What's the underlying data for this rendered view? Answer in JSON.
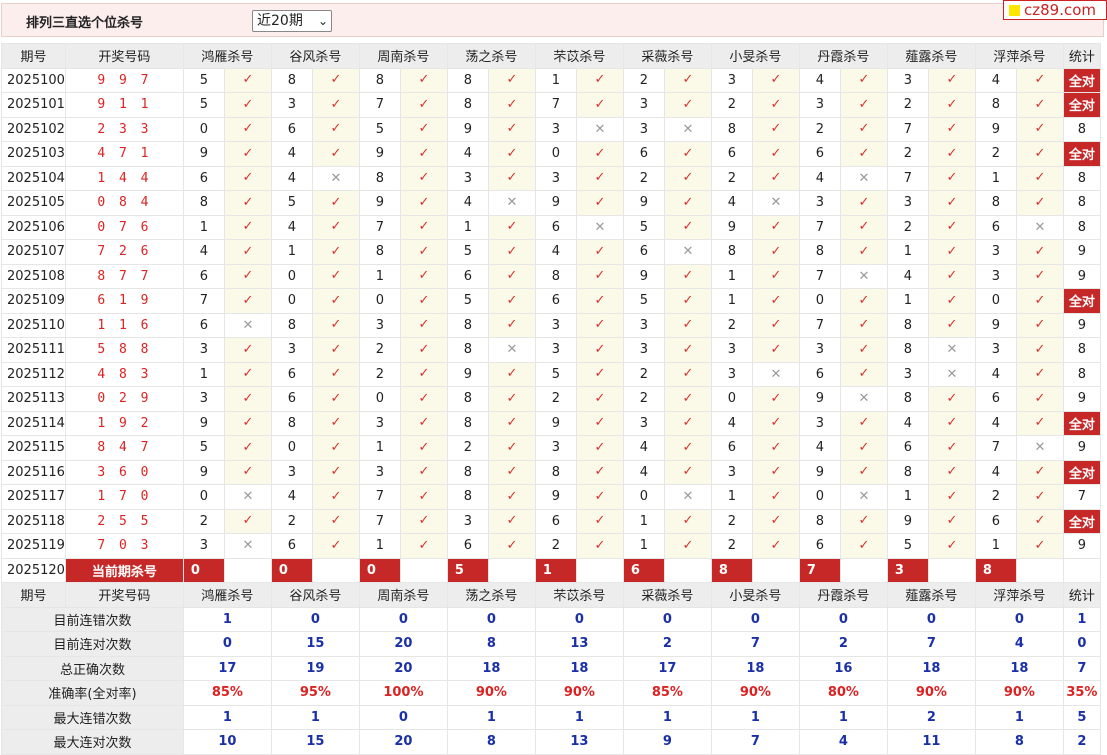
{
  "header": {
    "title": "排列三直选个位杀号",
    "range_label": "近20期",
    "logo_text": "cz89.com"
  },
  "columns": {
    "period": "期号",
    "draw": "开奖号码",
    "stat": "统计",
    "experts": [
      "鸿雁杀号",
      "谷风杀号",
      "周南杀号",
      "荡之杀号",
      "芣苡杀号",
      "采薇杀号",
      "小旻杀号",
      "丹霞杀号",
      "薤露杀号",
      "浮萍杀号"
    ]
  },
  "rows": [
    {
      "period": "2025100",
      "draw": "9 9 7",
      "kills": [
        5,
        8,
        8,
        8,
        1,
        2,
        3,
        4,
        3,
        4
      ],
      "hits": [
        1,
        1,
        1,
        1,
        1,
        1,
        1,
        1,
        1,
        1
      ],
      "stat": "全对"
    },
    {
      "period": "2025101",
      "draw": "9 1 1",
      "kills": [
        5,
        3,
        7,
        8,
        7,
        3,
        2,
        3,
        2,
        8
      ],
      "hits": [
        1,
        1,
        1,
        1,
        1,
        1,
        1,
        1,
        1,
        1
      ],
      "stat": "全对"
    },
    {
      "period": "2025102",
      "draw": "2 3 3",
      "kills": [
        0,
        6,
        5,
        9,
        3,
        3,
        8,
        2,
        7,
        9
      ],
      "hits": [
        1,
        1,
        1,
        1,
        0,
        0,
        1,
        1,
        1,
        1
      ],
      "stat": "8"
    },
    {
      "period": "2025103",
      "draw": "4 7 1",
      "kills": [
        9,
        4,
        9,
        4,
        0,
        6,
        6,
        6,
        2,
        2
      ],
      "hits": [
        1,
        1,
        1,
        1,
        1,
        1,
        1,
        1,
        1,
        1
      ],
      "stat": "全对"
    },
    {
      "period": "2025104",
      "draw": "1 4 4",
      "kills": [
        6,
        4,
        8,
        3,
        3,
        2,
        2,
        4,
        7,
        1
      ],
      "hits": [
        1,
        0,
        1,
        1,
        1,
        1,
        1,
        0,
        1,
        1
      ],
      "stat": "8"
    },
    {
      "period": "2025105",
      "draw": "0 8 4",
      "kills": [
        8,
        5,
        9,
        4,
        9,
        9,
        4,
        3,
        3,
        8
      ],
      "hits": [
        1,
        1,
        1,
        0,
        1,
        1,
        0,
        1,
        1,
        1
      ],
      "stat": "8"
    },
    {
      "period": "2025106",
      "draw": "0 7 6",
      "kills": [
        1,
        4,
        7,
        1,
        6,
        5,
        9,
        7,
        2,
        6
      ],
      "hits": [
        1,
        1,
        1,
        1,
        0,
        1,
        1,
        1,
        1,
        0
      ],
      "stat": "8"
    },
    {
      "period": "2025107",
      "draw": "7 2 6",
      "kills": [
        4,
        1,
        8,
        5,
        4,
        6,
        8,
        8,
        1,
        3
      ],
      "hits": [
        1,
        1,
        1,
        1,
        1,
        0,
        1,
        1,
        1,
        1
      ],
      "stat": "9"
    },
    {
      "period": "2025108",
      "draw": "8 7 7",
      "kills": [
        6,
        0,
        1,
        6,
        8,
        9,
        1,
        7,
        4,
        3
      ],
      "hits": [
        1,
        1,
        1,
        1,
        1,
        1,
        1,
        0,
        1,
        1
      ],
      "stat": "9"
    },
    {
      "period": "2025109",
      "draw": "6 1 9",
      "kills": [
        7,
        0,
        0,
        5,
        6,
        5,
        1,
        0,
        1,
        0
      ],
      "hits": [
        1,
        1,
        1,
        1,
        1,
        1,
        1,
        1,
        1,
        1
      ],
      "stat": "全对"
    },
    {
      "period": "2025110",
      "draw": "1 1 6",
      "kills": [
        6,
        8,
        3,
        8,
        3,
        3,
        2,
        7,
        8,
        9
      ],
      "hits": [
        0,
        1,
        1,
        1,
        1,
        1,
        1,
        1,
        1,
        1
      ],
      "stat": "9"
    },
    {
      "period": "2025111",
      "draw": "5 8 8",
      "kills": [
        3,
        3,
        2,
        8,
        3,
        3,
        3,
        3,
        8,
        3
      ],
      "hits": [
        1,
        1,
        1,
        0,
        1,
        1,
        1,
        1,
        0,
        1
      ],
      "stat": "8"
    },
    {
      "period": "2025112",
      "draw": "4 8 3",
      "kills": [
        1,
        6,
        2,
        9,
        5,
        2,
        3,
        6,
        3,
        4
      ],
      "hits": [
        1,
        1,
        1,
        1,
        1,
        1,
        0,
        1,
        0,
        1
      ],
      "stat": "8"
    },
    {
      "period": "2025113",
      "draw": "0 2 9",
      "kills": [
        3,
        6,
        0,
        8,
        2,
        2,
        0,
        9,
        8,
        6
      ],
      "hits": [
        1,
        1,
        1,
        1,
        1,
        1,
        1,
        0,
        1,
        1
      ],
      "stat": "9"
    },
    {
      "period": "2025114",
      "draw": "1 9 2",
      "kills": [
        9,
        8,
        3,
        8,
        9,
        3,
        4,
        3,
        4,
        4
      ],
      "hits": [
        1,
        1,
        1,
        1,
        1,
        1,
        1,
        1,
        1,
        1
      ],
      "stat": "全对"
    },
    {
      "period": "2025115",
      "draw": "8 4 7",
      "kills": [
        5,
        0,
        1,
        2,
        3,
        4,
        6,
        4,
        6,
        7
      ],
      "hits": [
        1,
        1,
        1,
        1,
        1,
        1,
        1,
        1,
        1,
        0
      ],
      "stat": "9"
    },
    {
      "period": "2025116",
      "draw": "3 6 0",
      "kills": [
        9,
        3,
        3,
        8,
        8,
        4,
        3,
        9,
        8,
        4
      ],
      "hits": [
        1,
        1,
        1,
        1,
        1,
        1,
        1,
        1,
        1,
        1
      ],
      "stat": "全对"
    },
    {
      "period": "2025117",
      "draw": "1 7 0",
      "kills": [
        0,
        4,
        7,
        8,
        9,
        0,
        1,
        0,
        1,
        2
      ],
      "hits": [
        0,
        1,
        1,
        1,
        1,
        0,
        1,
        0,
        1,
        1
      ],
      "stat": "7"
    },
    {
      "period": "2025118",
      "draw": "2 5 5",
      "kills": [
        2,
        2,
        7,
        3,
        6,
        1,
        2,
        8,
        9,
        6
      ],
      "hits": [
        1,
        1,
        1,
        1,
        1,
        1,
        1,
        1,
        1,
        1
      ],
      "stat": "全对"
    },
    {
      "period": "2025119",
      "draw": "7 0 3",
      "kills": [
        3,
        6,
        1,
        6,
        2,
        1,
        2,
        6,
        5,
        1
      ],
      "hits": [
        0,
        1,
        1,
        1,
        1,
        1,
        1,
        1,
        1,
        1
      ],
      "stat": "9"
    }
  ],
  "current": {
    "period": "2025120",
    "label": "当前期杀号",
    "kills": [
      0,
      0,
      0,
      5,
      1,
      6,
      8,
      7,
      3,
      8
    ]
  },
  "stats": [
    {
      "label": "目前连错次数",
      "values": [
        "1",
        "0",
        "0",
        "0",
        "0",
        "0",
        "0",
        "0",
        "0",
        "0",
        "1"
      ],
      "color": "blue"
    },
    {
      "label": "目前连对次数",
      "values": [
        "0",
        "15",
        "20",
        "8",
        "13",
        "2",
        "7",
        "2",
        "7",
        "4",
        "0"
      ],
      "color": "blue"
    },
    {
      "label": "总正确次数",
      "values": [
        "17",
        "19",
        "20",
        "18",
        "18",
        "17",
        "18",
        "16",
        "18",
        "18",
        "7"
      ],
      "color": "blue"
    },
    {
      "label": "准确率(全对率)",
      "values": [
        "85%",
        "95%",
        "100%",
        "90%",
        "90%",
        "85%",
        "90%",
        "80%",
        "90%",
        "90%",
        "35%"
      ],
      "color": "red"
    },
    {
      "label": "最大连错次数",
      "values": [
        "1",
        "1",
        "0",
        "1",
        "1",
        "1",
        "1",
        "1",
        "2",
        "1",
        "5"
      ],
      "color": "blue"
    },
    {
      "label": "最大连对次数",
      "values": [
        "10",
        "15",
        "20",
        "8",
        "13",
        "9",
        "7",
        "4",
        "11",
        "8",
        "2"
      ],
      "color": "blue"
    }
  ],
  "symbols": {
    "hit": "✓",
    "miss": "✕"
  }
}
